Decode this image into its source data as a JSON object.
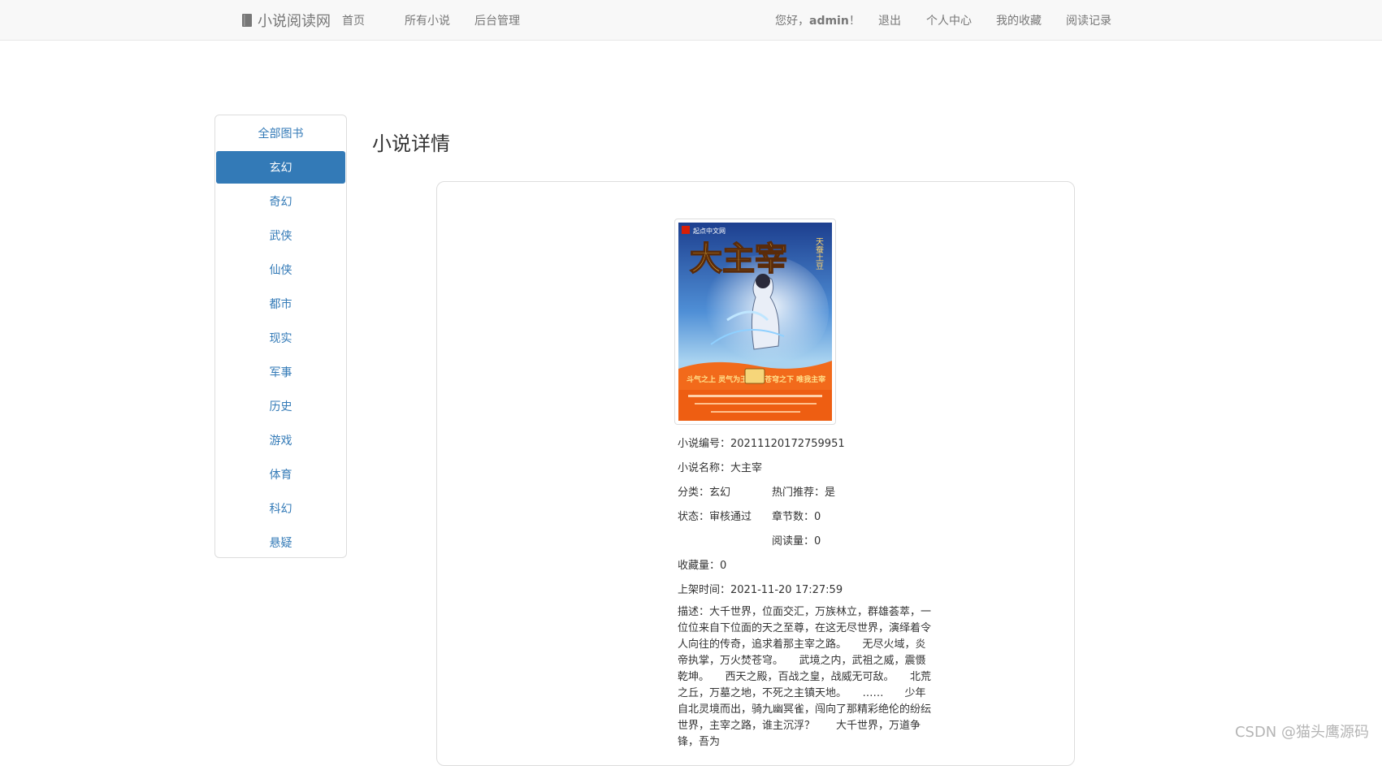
{
  "nav": {
    "brand": "小说阅读网",
    "links": [
      "首页",
      "所有小说",
      "后台管理"
    ],
    "greeting_prefix": "您好，",
    "username": "admin",
    "greeting_suffix": "！",
    "right_links": [
      "退出",
      "个人中心",
      "我的收藏",
      "阅读记录"
    ]
  },
  "sidebar": {
    "items": [
      "全部图书",
      "玄幻",
      "奇幻",
      "武侠",
      "仙侠",
      "都市",
      "现实",
      "军事",
      "历史",
      "游戏",
      "体育",
      "科幻",
      "悬疑"
    ],
    "active": "玄幻"
  },
  "main": {
    "title": "小说详情",
    "cover": {
      "publisher": "起点中文网",
      "title_art": "大主宰",
      "author_art": "天蚕土豆",
      "tagline_left": "斗气之上 灵气为王",
      "tagline_right": "苍穹之下 唯我主宰"
    },
    "fields": {
      "id_label": "小说编号：",
      "id_value": "20211120172759951",
      "name_label": "小说名称：",
      "name_value": "大主宰",
      "category_label": "分类：",
      "category_value": "玄幻",
      "hot_label": "热门推荐：",
      "hot_value": "是",
      "status_label": "状态：",
      "status_value": "审核通过",
      "chapters_label": "章节数：",
      "chapters_value": "0",
      "reads_label": "阅读量：",
      "reads_value": "0",
      "favorites_label": "收藏量：",
      "favorites_value": "0",
      "shelf_label": "上架时间：",
      "shelf_value": "2021-11-20 17:27:59",
      "desc_label": "描述：",
      "desc_value": "大千世界，位面交汇，万族林立，群雄荟萃，一位位来自下位面的天之至尊，在这无尽世界，演绎着令人向往的传奇，追求着那主宰之路。　　无尽火域，炎帝执掌，万火焚苍穹。　　武境之内，武祖之威，震慑乾坤。　　西天之殿，百战之皇，战威无可敌。　　北荒之丘，万墓之地，不死之主镇天地。　　……　　少年自北灵境而出，骑九幽冥雀，闯向了那精彩绝伦的纷纭世界，主宰之路，谁主沉浮？　　大千世界，万道争锋，吾为"
    }
  },
  "watermark": "CSDN @猫头鹰源码",
  "colors": {
    "primary": "#337ab7",
    "nav_bg": "#f8f8f8",
    "nav_text": "#777777",
    "border": "#dddddd"
  }
}
